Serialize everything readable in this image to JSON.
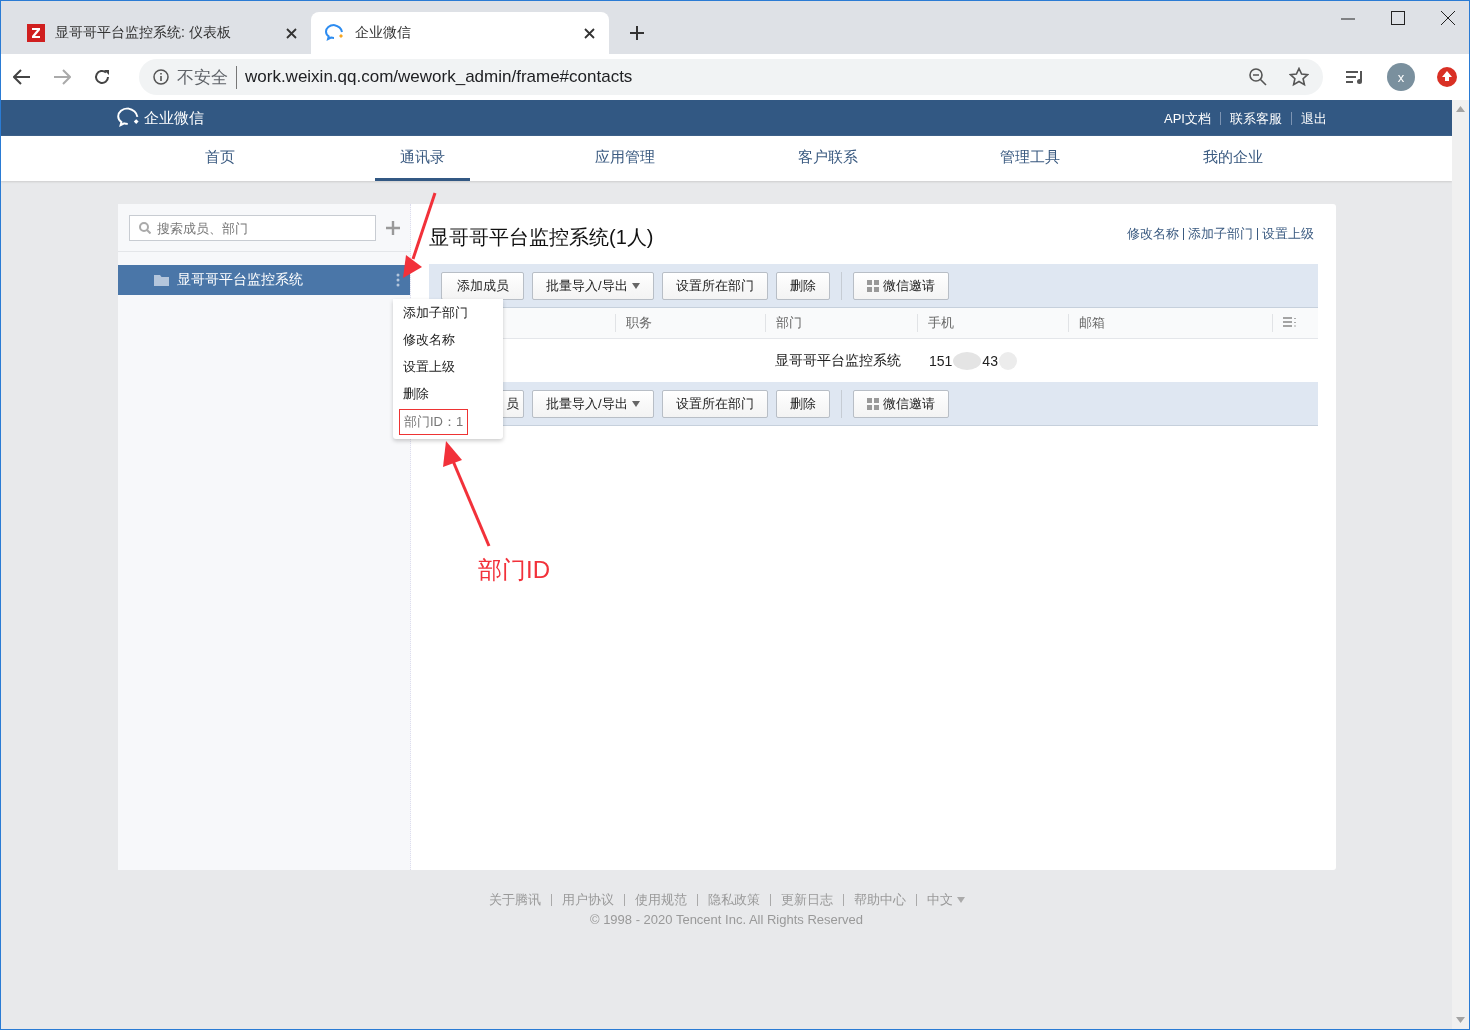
{
  "browser": {
    "tabs": [
      {
        "title": "显哥哥平台监控系统: 仪表板",
        "kind": "z",
        "selected": false
      },
      {
        "title": "企业微信",
        "kind": "wework",
        "selected": true
      }
    ],
    "address": {
      "security": "不安全",
      "url": "work.weixin.qq.com/wework_admin/frame#contacts"
    },
    "profile": "x"
  },
  "header": {
    "logo": "企业微信",
    "links": [
      "API文档",
      "联系客服",
      "退出"
    ]
  },
  "nav": [
    {
      "label": "首页",
      "selected": false
    },
    {
      "label": "通讯录",
      "selected": true
    },
    {
      "label": "应用管理",
      "selected": false
    },
    {
      "label": "客户联系",
      "selected": false
    },
    {
      "label": "管理工具",
      "selected": false
    },
    {
      "label": "我的企业",
      "selected": false
    }
  ],
  "sidebar": {
    "placeholder": "搜索成员、部门",
    "departments": [
      {
        "name": "显哥哥平台监控系统",
        "selected": true
      }
    ]
  },
  "menu": {
    "items": [
      "添加子部门",
      "修改名称",
      "设置上级",
      "删除"
    ],
    "dept_id": "部门ID：1"
  },
  "main": {
    "title": "显哥哥平台监控系统(1人)",
    "actions": [
      "修改名称",
      "添加子部门",
      "设置上级"
    ],
    "toolbar_top": [
      {
        "label": "添加成员",
        "kind": "plain"
      },
      {
        "label": "批量导入/导出",
        "kind": "dropdown"
      },
      {
        "label": "设置所在部门",
        "kind": "plain"
      },
      {
        "label": "删除",
        "kind": "plain"
      },
      {
        "label": "微信邀请",
        "kind": "qr"
      }
    ],
    "columns": [
      "职务",
      "部门",
      "手机",
      "邮箱"
    ],
    "rows": [
      {
        "department": "显哥哥平台监控系统",
        "phone_start": "151",
        "phone_end": "43"
      }
    ],
    "toolbar_bottom": [
      {
        "label": "员",
        "kind": "plain"
      },
      {
        "label": "批量导入/导出",
        "kind": "dropdown"
      },
      {
        "label": "设置所在部门",
        "kind": "plain"
      },
      {
        "label": "删除",
        "kind": "plain"
      },
      {
        "label": "微信邀请",
        "kind": "qr"
      }
    ]
  },
  "annotation": {
    "label": "部门ID"
  },
  "footer": {
    "links": [
      "关于腾讯",
      "用户协议",
      "使用规范",
      "隐私政策",
      "更新日志",
      "帮助中心",
      "中文"
    ],
    "copyright": "© 1998 - 2020 Tencent Inc. All Rights Reserved"
  }
}
